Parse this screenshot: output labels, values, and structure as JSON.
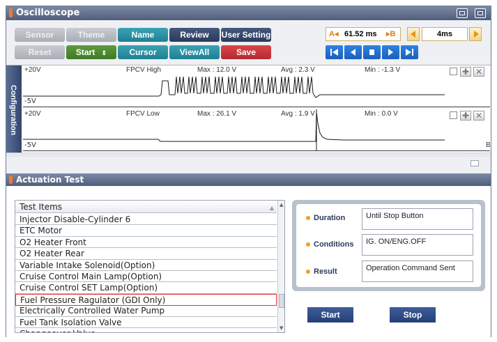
{
  "window": {
    "title": "Oscilloscope"
  },
  "toolbar": {
    "sensor": "Sensor",
    "theme": "Theme",
    "name": "Name",
    "review": "Review",
    "user_setting": "User Setting",
    "reset": "Reset",
    "start": "Start",
    "cursor": "Cursor",
    "view_all": "ViewAll",
    "save": "Save"
  },
  "cursor_readout": {
    "a_label": "A",
    "value": "61.52 ms",
    "b_label": "B",
    "time_div": "4ms"
  },
  "side_tab": {
    "label": "Configuration"
  },
  "channels": [
    {
      "max_label": "+20V",
      "name": "FPCV High",
      "max": "Max : 12.0 V",
      "avg": "Avg : 2.3 V",
      "min": "Min : -1.3 V",
      "min_label": "-5V"
    },
    {
      "max_label": "+20V",
      "name": "FPCV Low",
      "max": "Max : 26.1 V",
      "avg": "Avg : 1.9 V",
      "min": "Min : 0.0 V",
      "min_label": "-5V",
      "marker": "B"
    }
  ],
  "actuation": {
    "title": "Actuation Test",
    "list_header": "Test Items",
    "items": [
      "Injector Disable-Cylinder 6",
      "ETC Motor",
      "O2 Heater Front",
      "O2 Heater Rear",
      "Variable Intake Solenoid(Option)",
      "Cruise Control Main Lamp(Option)",
      "Cruise Control SET Lamp(Option)",
      "Fuel Pressure Ragulator (GDI Only)",
      "Electrically Controlled Water Pump",
      "Fuel Tank Isolation Valve",
      "Changeover Valve"
    ],
    "selected_index": 7,
    "duration_label": "Duration",
    "duration_value": "Until Stop Button",
    "conditions_label": "Conditions",
    "conditions_value": "IG. ON/ENG.OFF",
    "result_label": "Result",
    "result_value": "Operation Command Sent",
    "start_button": "Start",
    "stop_button": "Stop"
  },
  "colors": {
    "accent_orange": "#f07a2a",
    "teal": "#1f7f93",
    "navy": "#2a3a5c",
    "selected_border": "#e23232",
    "playback_blue": "#1a5fc0"
  }
}
